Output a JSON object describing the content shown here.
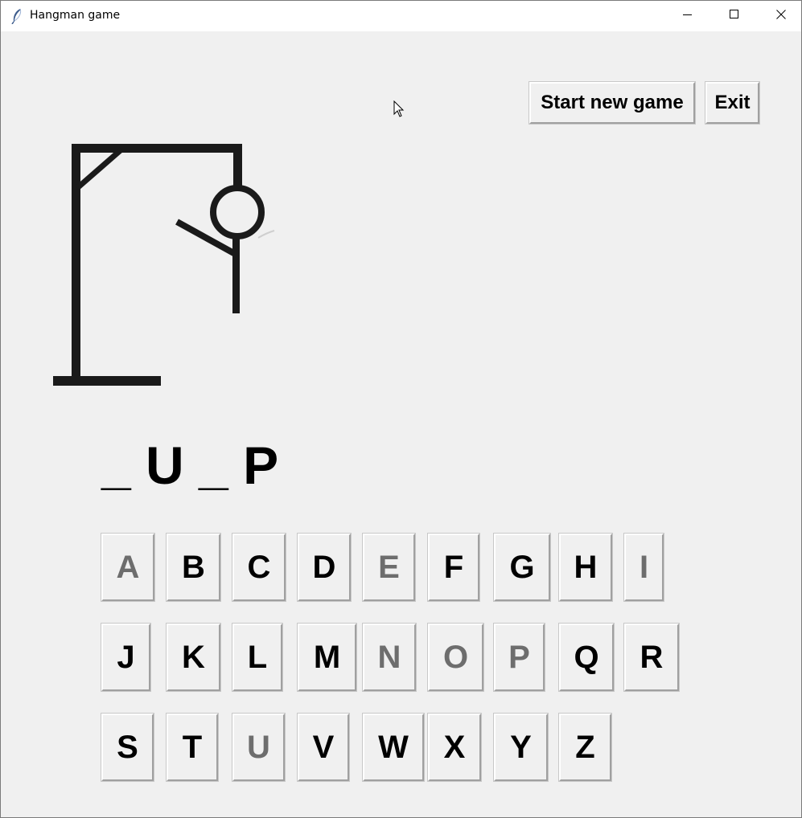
{
  "window": {
    "title": "Hangman game"
  },
  "controls": {
    "new_game_label": "Start new game",
    "exit_label": "Exit"
  },
  "game": {
    "word_display": "_ U _ P",
    "wrong_guess_parts": [
      "head",
      "body",
      "left-arm"
    ]
  },
  "keyboard": {
    "rows": [
      [
        {
          "letter": "A",
          "used": true
        },
        {
          "letter": "B",
          "used": false
        },
        {
          "letter": "C",
          "used": false
        },
        {
          "letter": "D",
          "used": false
        },
        {
          "letter": "E",
          "used": true
        },
        {
          "letter": "F",
          "used": false
        },
        {
          "letter": "G",
          "used": false
        },
        {
          "letter": "H",
          "used": false
        },
        {
          "letter": "I",
          "used": true
        }
      ],
      [
        {
          "letter": "J",
          "used": false
        },
        {
          "letter": "K",
          "used": false
        },
        {
          "letter": "L",
          "used": false
        },
        {
          "letter": "M",
          "used": false
        },
        {
          "letter": "N",
          "used": true
        },
        {
          "letter": "O",
          "used": true
        },
        {
          "letter": "P",
          "used": true
        },
        {
          "letter": "Q",
          "used": false
        },
        {
          "letter": "R",
          "used": false
        }
      ],
      [
        {
          "letter": "S",
          "used": false
        },
        {
          "letter": "T",
          "used": false
        },
        {
          "letter": "U",
          "used": true
        },
        {
          "letter": "V",
          "used": false
        },
        {
          "letter": "W",
          "used": false
        },
        {
          "letter": "X",
          "used": false
        },
        {
          "letter": "Y",
          "used": false
        },
        {
          "letter": "Z",
          "used": false
        }
      ]
    ]
  },
  "colors": {
    "background": "#f0f0f0",
    "used_letter": "#6d6d6d",
    "active_letter": "#000000"
  },
  "icons": {
    "app": "feather-icon",
    "minimize": "minimize-icon",
    "maximize": "maximize-icon",
    "close": "close-icon"
  }
}
